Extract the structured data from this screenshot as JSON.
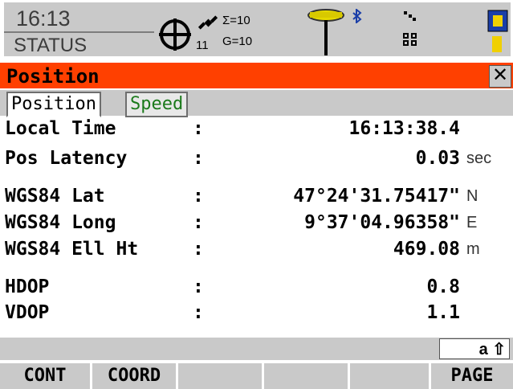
{
  "header": {
    "time": "16:13",
    "mode": "STATUS",
    "status": {
      "satellites_count": "11",
      "sigma": "Σ=10",
      "gps": "G=10"
    }
  },
  "panel": {
    "title": "Position",
    "close_label": "✕"
  },
  "tabs": [
    {
      "label": "Position",
      "active": true
    },
    {
      "label": "Speed",
      "active": false
    }
  ],
  "rows": [
    {
      "label": "Local Time",
      "colon": ":",
      "value": "16:13:38.4",
      "unit": ""
    },
    {
      "label": "Pos Latency",
      "colon": ":",
      "value": "0.03",
      "unit": "sec"
    },
    {
      "label": "WGS84 Lat",
      "colon": ":",
      "value": "47°24'31.75417\"",
      "unit": "N"
    },
    {
      "label": "WGS84 Long",
      "colon": ":",
      "value": "9°37'04.96358\"",
      "unit": "E"
    },
    {
      "label": "WGS84 Ell Ht",
      "colon": ":",
      "value": "469.08",
      "unit": "m"
    },
    {
      "label": "HDOP",
      "colon": ":",
      "value": "0.8",
      "unit": ""
    },
    {
      "label": "VDOP",
      "colon": ":",
      "value": "1.1",
      "unit": ""
    }
  ],
  "input_mode": "a ⇧",
  "fkeys": [
    "CONT",
    "COORD",
    "",
    "",
    "",
    "PAGE"
  ],
  "colors": {
    "title_bar": "#ff4000",
    "panel_grey": "#c9c9c9",
    "tab_inactive_text": "#1b7a1b"
  }
}
